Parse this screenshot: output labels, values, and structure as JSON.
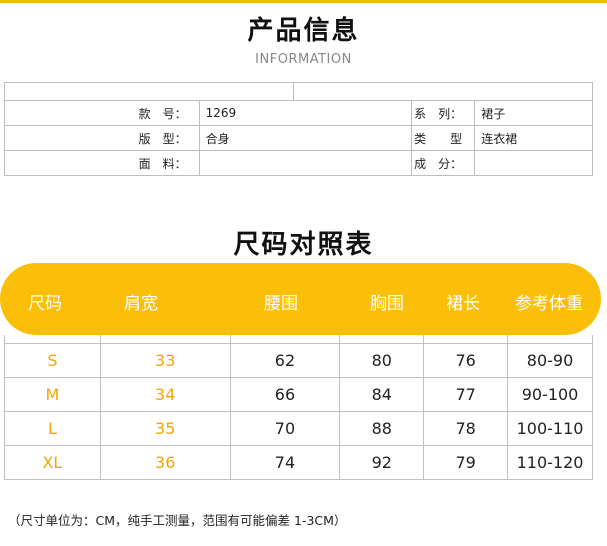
{
  "header": {
    "title": "产品信息",
    "subtitle": "INFORMATION"
  },
  "info": {
    "rows": [
      {
        "l1": "款　号：",
        "v1": "1269",
        "l2": "系　列：",
        "v2": "裙子"
      },
      {
        "l1": "版　型：",
        "v1": "合身",
        "l2": "类　　型",
        "v2": "连衣裙"
      },
      {
        "l1": "面　料：",
        "v1": "",
        "l2": "成　分：",
        "v2": ""
      }
    ]
  },
  "size_table": {
    "title": "尺码对照表",
    "headers": [
      "尺码",
      "肩宽",
      "腰围",
      "胸围",
      "裙长",
      "参考体重"
    ],
    "rows": [
      [
        "S",
        "33",
        "62",
        "80",
        "76",
        "80-90"
      ],
      [
        "M",
        "34",
        "66",
        "84",
        "77",
        "90-100"
      ],
      [
        "L",
        "35",
        "70",
        "88",
        "78",
        "100-110"
      ],
      [
        "XL",
        "36",
        "74",
        "92",
        "79",
        "110-120"
      ]
    ]
  },
  "note": "（尺寸单位为：CM，纯手工测量，范围有可能偏差 1-3CM）",
  "colors": {
    "accent": "#fbbf0a",
    "accent_text": "#f0a800",
    "border": "#bdbdbd"
  }
}
